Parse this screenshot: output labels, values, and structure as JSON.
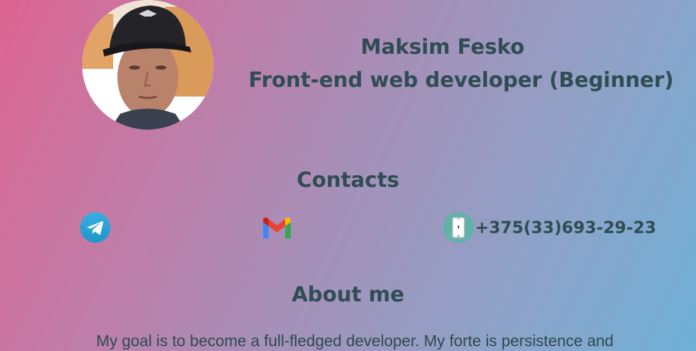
{
  "header": {
    "name": "Maksim Fesko",
    "role": "Front-end web developer (Beginner)"
  },
  "avatar": {
    "icon": "profile-photo"
  },
  "contacts": {
    "title": "Contacts",
    "items": [
      {
        "icon": "telegram-icon",
        "label": ""
      },
      {
        "icon": "gmail-icon",
        "label": ""
      },
      {
        "icon": "phone-icon",
        "label": "+375(33)693-29-23"
      }
    ]
  },
  "about": {
    "title": "About me",
    "text": "My goal is to become a full-fledged developer. My forte is persistence and"
  },
  "colors": {
    "text": "#2f4d52",
    "telegram": "#2aa3e0",
    "phone_bg": "#5fb3a8",
    "gradient_start": "#dc6590",
    "gradient_end": "#6fb0d6"
  }
}
